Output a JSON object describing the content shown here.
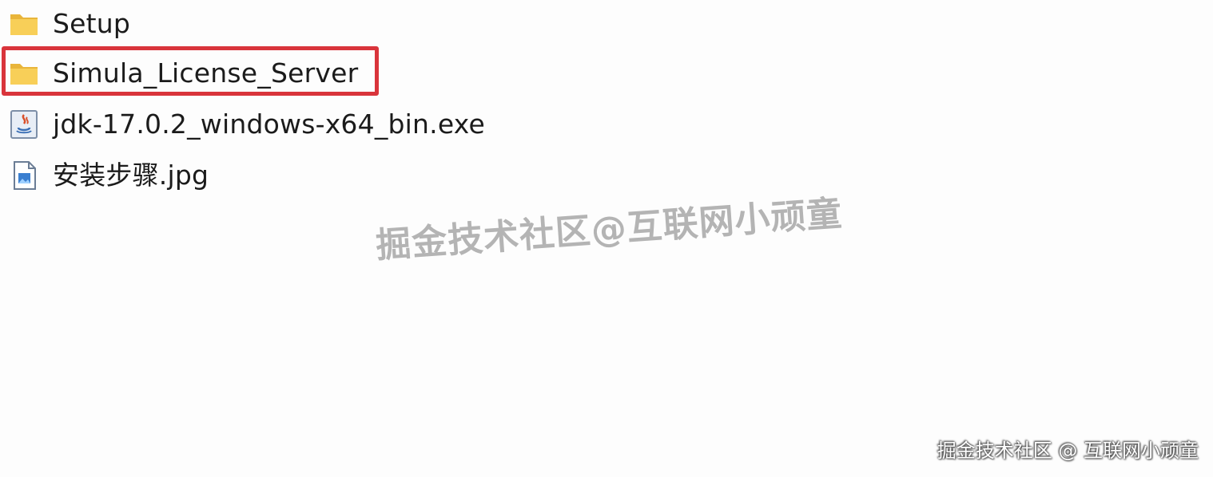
{
  "files": [
    {
      "name": "Setup",
      "icon": "folder-icon"
    },
    {
      "name": "Simula_License_Server",
      "icon": "folder-icon",
      "highlighted": true
    },
    {
      "name": "jdk-17.0.2_windows-x64_bin.exe",
      "icon": "java-installer-icon"
    },
    {
      "name": "安装步骤.jpg",
      "icon": "image-file-icon"
    }
  ],
  "watermark": {
    "center_text": "掘金技术社区@互联网小顽童",
    "corner_text": "掘金技术社区 @ 互联网小顽童"
  },
  "colors": {
    "highlight": "#d9343b",
    "folder": "#f6c94a"
  }
}
